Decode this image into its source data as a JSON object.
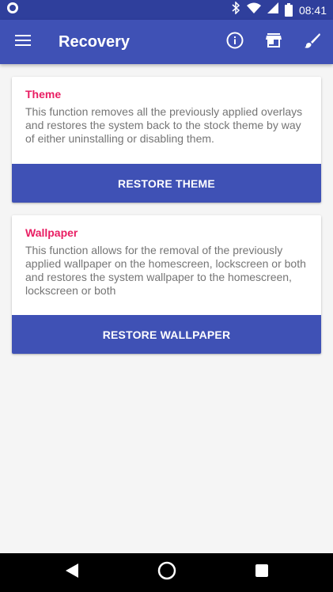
{
  "status_bar": {
    "time": "08:41",
    "battery_level": "",
    "icons": [
      "circle-notification-icon",
      "bluetooth-icon",
      "wifi-icon",
      "cell-signal-icon",
      "battery-icon"
    ]
  },
  "app_bar": {
    "title": "Recovery",
    "menu_icon": "hamburger-menu-icon",
    "actions": [
      "info-icon",
      "store-icon",
      "brush-icon"
    ]
  },
  "cards": [
    {
      "title": "Theme",
      "text": "This function removes all the previously applied overlays and restores the system back to the stock theme by way of either uninstalling or disabling them.",
      "button_label": "RESTORE THEME"
    },
    {
      "title": "Wallpaper",
      "text": "This function allows for the removal of the previously applied wallpaper on the homescreen, lockscreen or both and restores the system wallpaper to the homescreen, lockscreen or both",
      "button_label": "RESTORE WALLPAPER"
    }
  ],
  "nav_bar": {
    "buttons": [
      "back-icon",
      "home-icon",
      "recents-icon"
    ]
  },
  "colors": {
    "status_bar": "#2f3f9c",
    "primary": "#3f51b5",
    "accent": "#e91e63",
    "text_secondary": "#757575",
    "background": "#f5f5f5"
  }
}
